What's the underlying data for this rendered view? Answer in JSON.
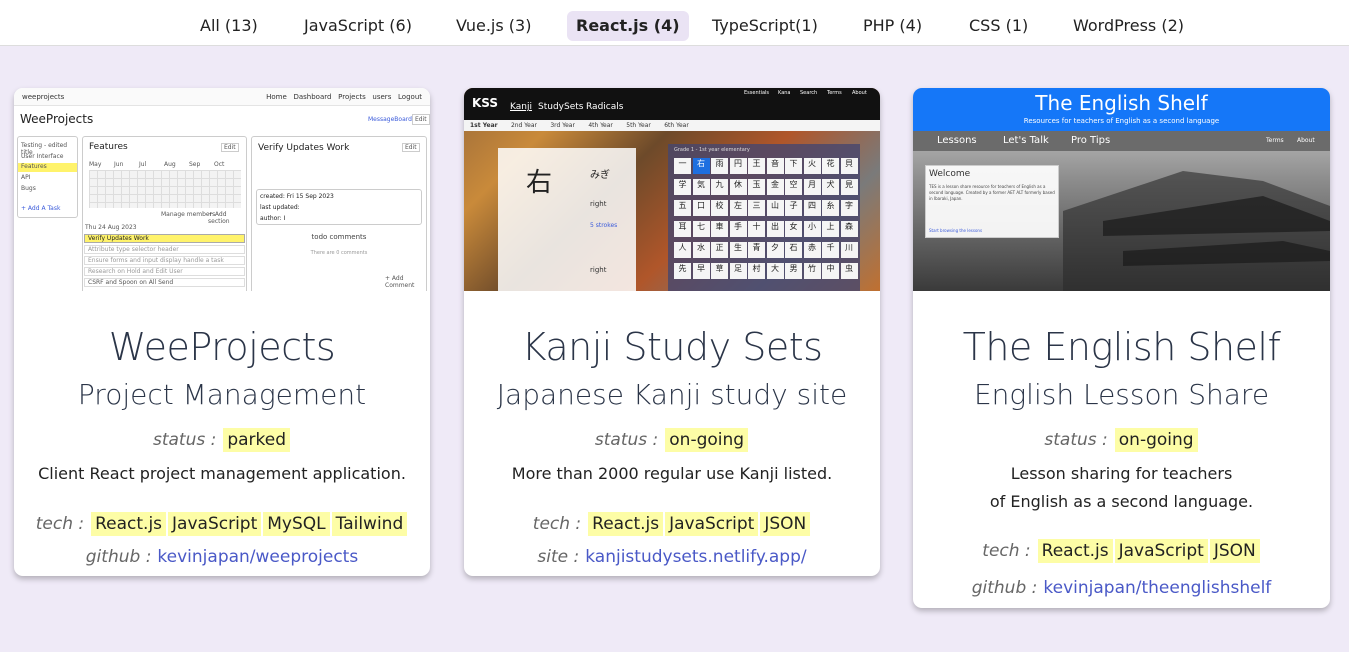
{
  "filters": [
    {
      "label": "All (13)",
      "active": false
    },
    {
      "label": "JavaScript (6)",
      "active": false
    },
    {
      "label": "Vue.js (3)",
      "active": false
    },
    {
      "label": "React.js (4)",
      "active": true
    },
    {
      "label": "TypeScript(1)",
      "active": false
    },
    {
      "label": "PHP (4)",
      "active": false
    },
    {
      "label": "CSS (1)",
      "active": false
    },
    {
      "label": "WordPress (2)",
      "active": false
    }
  ],
  "labels": {
    "status": "status :",
    "tech": "tech :",
    "github": "github :",
    "site": "site :"
  },
  "cards": [
    {
      "title": "WeeProjects",
      "subtitle": "Project Management",
      "status": "parked",
      "description": [
        "Client React project management application."
      ],
      "tech": [
        "React.js",
        "JavaScript",
        "MySQL",
        "Tailwind"
      ],
      "link_label": "github :",
      "link_text": "kevinjapan/weeprojects",
      "screenshot": {
        "brand": "weeprojects",
        "nav": [
          "Home",
          "Dashboard",
          "Projects",
          "users",
          "Logout"
        ],
        "heading": "WeeProjects",
        "message_board": "MessageBoard",
        "side_items": [
          "Testing - edited title",
          "User Interface",
          "Features",
          "API",
          "Bugs"
        ],
        "add_task": "+ Add A Task",
        "features_title": "Features",
        "months": [
          "May",
          "Jun",
          "Jul",
          "Aug",
          "Sep",
          "Oct"
        ],
        "date": "Thu 24 Aug 2023",
        "todo_items": [
          "Verify Updates Work",
          "Attribute type selector header",
          "Ensure forms and input display handle a task",
          "Research on Hold and Edit User",
          "CSRF and Spoon on All Send"
        ],
        "verify_title": "Verify Updates Work",
        "created": "created: Fri 15 Sep 2023",
        "updated": "last updated:",
        "author": "author: I",
        "todo_comments": "todo comments",
        "no_comments": "There are 0 comments",
        "add_comment": "+ Add Comment",
        "manage_members": "Manage members",
        "add_section": "+ Add section",
        "edit": "Edit"
      }
    },
    {
      "title": "Kanji Study Sets",
      "subtitle": "Japanese Kanji study site",
      "status": "on-going",
      "description": [
        "More than 2000 regular use Kanji listed."
      ],
      "tech": [
        "React.js",
        "JavaScript",
        "JSON"
      ],
      "link_label": "site :",
      "link_text": "kanjistudysets.netlify.app/",
      "screenshot": {
        "logo": "KSS",
        "nav": [
          "Kanji",
          "StudySets",
          "Radicals"
        ],
        "topnav": [
          "Essentials",
          "Kana",
          "Search",
          "Terms",
          "About"
        ],
        "years": [
          "1st Year",
          "2nd Year",
          "3rd Year",
          "4th Year",
          "5th Year",
          "6th Year"
        ],
        "big_kanji": "右",
        "reading": "みぎ",
        "meaning": "right",
        "strokes": "5 strokes",
        "grid_title": "Grade 1 - 1st year elementary",
        "kanji": [
          "一",
          "右",
          "雨",
          "円",
          "王",
          "音",
          "下",
          "火",
          "花",
          "貝",
          "学",
          "気",
          "九",
          "休",
          "玉",
          "金",
          "空",
          "月",
          "犬",
          "見",
          "五",
          "口",
          "校",
          "左",
          "三",
          "山",
          "子",
          "四",
          "糸",
          "字",
          "耳",
          "七",
          "車",
          "手",
          "十",
          "出",
          "女",
          "小",
          "上",
          "森",
          "人",
          "水",
          "正",
          "生",
          "青",
          "夕",
          "石",
          "赤",
          "千",
          "川",
          "先",
          "早",
          "草",
          "足",
          "村",
          "大",
          "男",
          "竹",
          "中",
          "虫"
        ]
      }
    },
    {
      "title": "The English Shelf",
      "subtitle": "English Lesson Share",
      "status": "on-going",
      "description": [
        "Lesson sharing for teachers",
        "of English as a second language."
      ],
      "tech": [
        "React.js",
        "JavaScript",
        "JSON"
      ],
      "link_label": "github :",
      "link_text": "kevinjapan/theenglishshelf",
      "screenshot": {
        "banner": "The English Shelf",
        "tagline": "Resources for teachers of English as a second language",
        "nav": [
          "Lessons",
          "Let's Talk",
          "Pro Tips"
        ],
        "nav_right": [
          "Terms",
          "About"
        ],
        "welcome": "Welcome",
        "welcome_text": "TES is a lesson share resource for teachers of English as a second language. Created by a former AET ALT formerly based in Ibaraki, Japan.",
        "welcome_link": "Start browsing the lessons"
      }
    }
  ],
  "colors": {
    "background": "#efeaf7",
    "tag": "#fdfda6",
    "link": "#4a59c7",
    "active_filter": "#eae3f4",
    "banner_blue": "#1577f8"
  }
}
